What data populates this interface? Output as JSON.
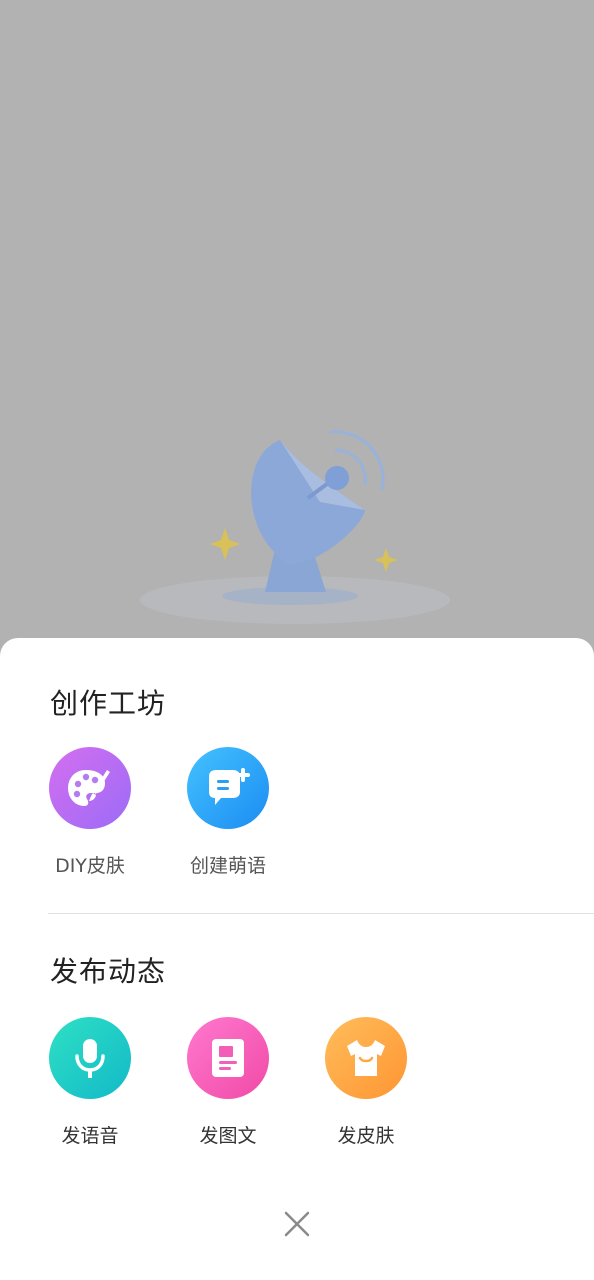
{
  "workshop": {
    "title": "创作工坊",
    "items": [
      {
        "label": "DIY皮肤",
        "icon": "palette-icon"
      },
      {
        "label": "创建萌语",
        "icon": "chat-add-icon"
      }
    ]
  },
  "publish": {
    "title": "发布动态",
    "items": [
      {
        "label": "发语音",
        "icon": "microphone-icon"
      },
      {
        "label": "发图文",
        "icon": "article-icon"
      },
      {
        "label": "发皮肤",
        "icon": "tshirt-icon"
      }
    ]
  },
  "close": {
    "icon": "close-icon"
  },
  "colors": {
    "purple": "#b06df3",
    "blue": "#2aa6f7",
    "teal": "#1ccdc6",
    "pink": "#f65ab8",
    "orange": "#ffa844"
  }
}
